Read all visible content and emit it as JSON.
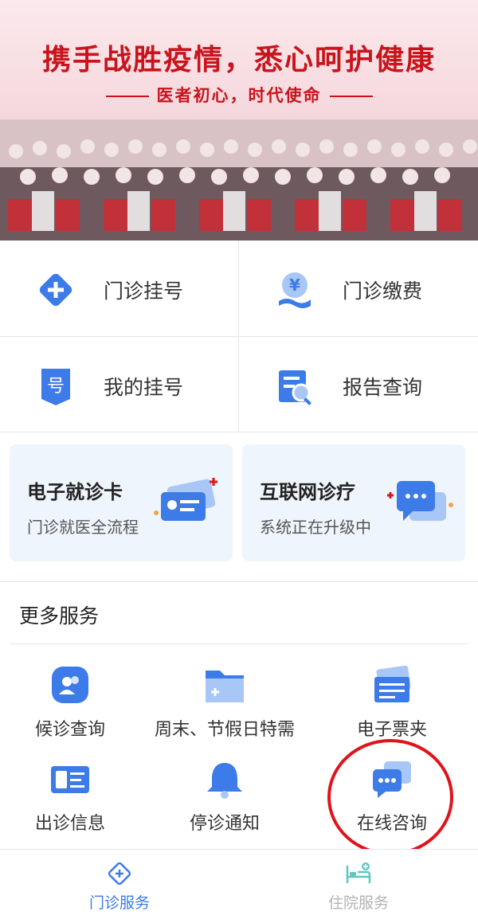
{
  "banner": {
    "title": "携手战胜疫情，悉心呵护健康",
    "subtitle": "医者初心，时代使命"
  },
  "quick": [
    {
      "label": "门诊挂号",
      "icon": "plus-diamond-icon"
    },
    {
      "label": "门诊缴费",
      "icon": "yen-payment-icon"
    },
    {
      "label": "我的挂号",
      "icon": "ticket-number-icon"
    },
    {
      "label": "报告查询",
      "icon": "report-search-icon"
    }
  ],
  "cards": [
    {
      "title": "电子就诊卡",
      "desc": "门诊就医全流程",
      "icon": "id-card-icon"
    },
    {
      "title": "互联网诊疗",
      "desc": "系统正在升级中",
      "icon": "chat-bubbles-icon"
    }
  ],
  "more": {
    "title": "更多服务",
    "items": [
      {
        "label": "候诊查询",
        "icon": "patients-icon"
      },
      {
        "label": "周末、节假日特需",
        "icon": "folder-plus-icon"
      },
      {
        "label": "电子票夹",
        "icon": "ticket-stack-icon"
      },
      {
        "label": "出诊信息",
        "icon": "doctor-card-icon"
      },
      {
        "label": "停诊通知",
        "icon": "bell-icon"
      },
      {
        "label": "在线咨询",
        "icon": "online-chat-icon"
      }
    ]
  },
  "tabs": [
    {
      "label": "门诊服务",
      "icon": "outpatient-icon",
      "active": true
    },
    {
      "label": "住院服务",
      "icon": "hospital-bed-icon",
      "active": false
    }
  ],
  "colors": {
    "accent": "#3c7be8",
    "iconLight": "#a9c7f6",
    "bannerRed": "#c8141c",
    "highlightCircle": "#e0131a",
    "cardBg": "#eff5fc",
    "tabInactive": "#b3b3b3"
  }
}
